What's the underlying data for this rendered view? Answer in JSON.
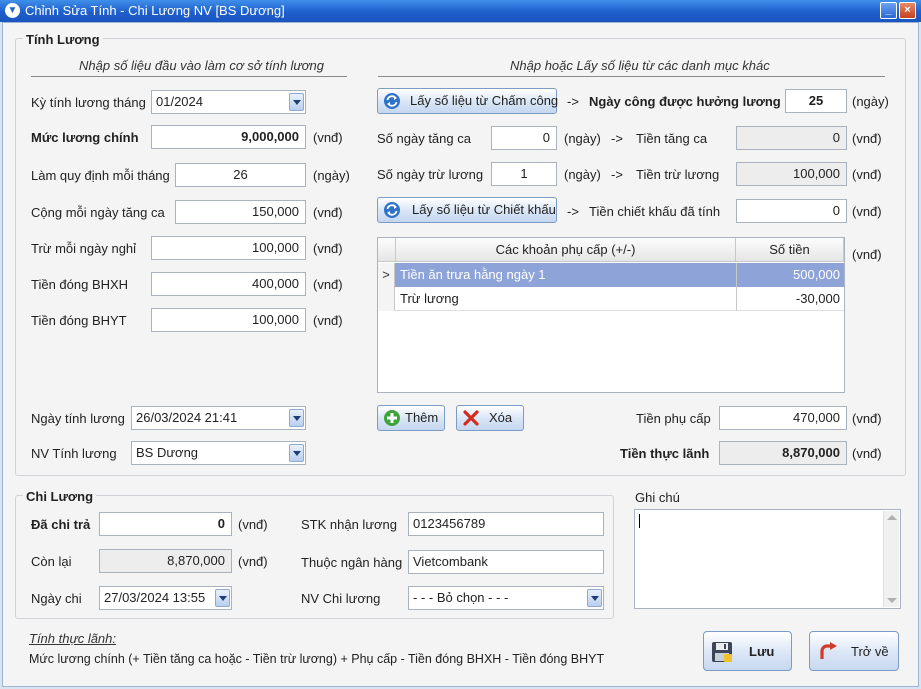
{
  "window": {
    "title": "Chỉnh Sửa Tính - Chi Lương NV [BS Dương]",
    "minimize": "_",
    "close": "×"
  },
  "tinh_luong": {
    "title": "Tính Lương",
    "left_caption": "Nhập số liệu đầu vào làm cơ sở tính lương",
    "right_caption": "Nhập hoặc Lấy số liệu từ các danh mục khác",
    "ky_tinh_luong": {
      "label": "Kỳ tính lương tháng",
      "value": "01/2024"
    },
    "muc_luong_chinh": {
      "label": "Mức lương chính",
      "value": "9,000,000",
      "unit": "(vnđ)"
    },
    "lam_quy_dinh": {
      "label": "Làm quy định mỗi tháng",
      "value": "26",
      "unit": "(ngày)"
    },
    "cong_tang_ca": {
      "label": "Cộng mỗi ngày tăng ca",
      "value": "150,000",
      "unit": "(vnđ)"
    },
    "tru_ngay_nghi": {
      "label": "Trừ mỗi ngày nghỉ",
      "value": "100,000",
      "unit": "(vnđ)"
    },
    "bhxh": {
      "label": "Tiền đóng BHXH",
      "value": "400,000",
      "unit": "(vnđ)"
    },
    "bhyt": {
      "label": "Tiền đóng BHYT",
      "value": "100,000",
      "unit": "(vnđ)"
    },
    "ngay_tinh_luong": {
      "label": "Ngày tính lương",
      "value": "26/03/2024 21:41"
    },
    "nv_tinh_luong": {
      "label": "NV Tính lương",
      "value": "BS Dương"
    },
    "lay_cham_cong": {
      "button": "Lấy số liệu từ Chấm công",
      "arrow": "->",
      "label": "Ngày công được hưởng lương",
      "value": "25",
      "unit": "(ngày)"
    },
    "tang_ca": {
      "label": "Số ngày tăng ca",
      "value": "0",
      "unit_day": "(ngày)",
      "arrow": "->",
      "label2": "Tiền tăng ca",
      "value2": "0",
      "unit": "(vnđ)"
    },
    "tru_luong": {
      "label": "Số ngày trừ lương",
      "value": "1",
      "unit_day": "(ngày)",
      "arrow": "->",
      "label2": "Tiền trừ lương",
      "value2": "100,000",
      "unit": "(vnđ)"
    },
    "lay_chiet_khau": {
      "button": "Lấy số liệu từ Chiết khấu",
      "arrow": "->",
      "label": "Tiền chiết khấu đã tính",
      "value": "0",
      "unit": "(vnđ)"
    },
    "phu_cap_grid": {
      "columns": [
        "Các khoản phụ cấp (+/-)",
        "Số tiền"
      ],
      "unit": "(vnđ)",
      "rows": [
        {
          "name": "Tiền ăn trưa hằng ngày 1",
          "amount": "500,000"
        },
        {
          "name": "Trừ lương",
          "amount": "-30,000"
        }
      ],
      "row_indicator": ">"
    },
    "them_button": "Thêm",
    "xoa_button": "Xóa",
    "tien_phu_cap": {
      "label": "Tiền phụ cấp",
      "value": "470,000",
      "unit": "(vnđ)"
    },
    "tien_thuc_lanh": {
      "label": "Tiền thực lãnh",
      "value": "8,870,000",
      "unit": "(vnđ)"
    }
  },
  "chi_luong": {
    "title": "Chi Lương",
    "da_chi_tra": {
      "label": "Đã chi trả",
      "value": "0",
      "unit": "(vnđ)"
    },
    "con_lai": {
      "label": "Còn lại",
      "value": "8,870,000",
      "unit": "(vnđ)"
    },
    "ngay_chi": {
      "label": "Ngày chi",
      "value": "27/03/2024 13:55"
    },
    "stk": {
      "label": "STK nhận lương",
      "value": "0123456789"
    },
    "ngan_hang": {
      "label": "Thuộc ngân hàng",
      "value": "Vietcombank"
    },
    "nv_chi_luong": {
      "label": "NV Chi lương",
      "value": "- - - Bỏ chọn - - -"
    }
  },
  "ghi_chu": {
    "label": "Ghi chú",
    "value": ""
  },
  "formula": {
    "title": "Tính thực lãnh:",
    "text": "Mức lương chính (+ Tiền tăng ca hoặc - Tiền trừ lương) + Phụ cấp - Tiền đóng BHXH - Tiền đóng BHYT"
  },
  "actions": {
    "save": "Lưu",
    "back": "Trở về"
  }
}
